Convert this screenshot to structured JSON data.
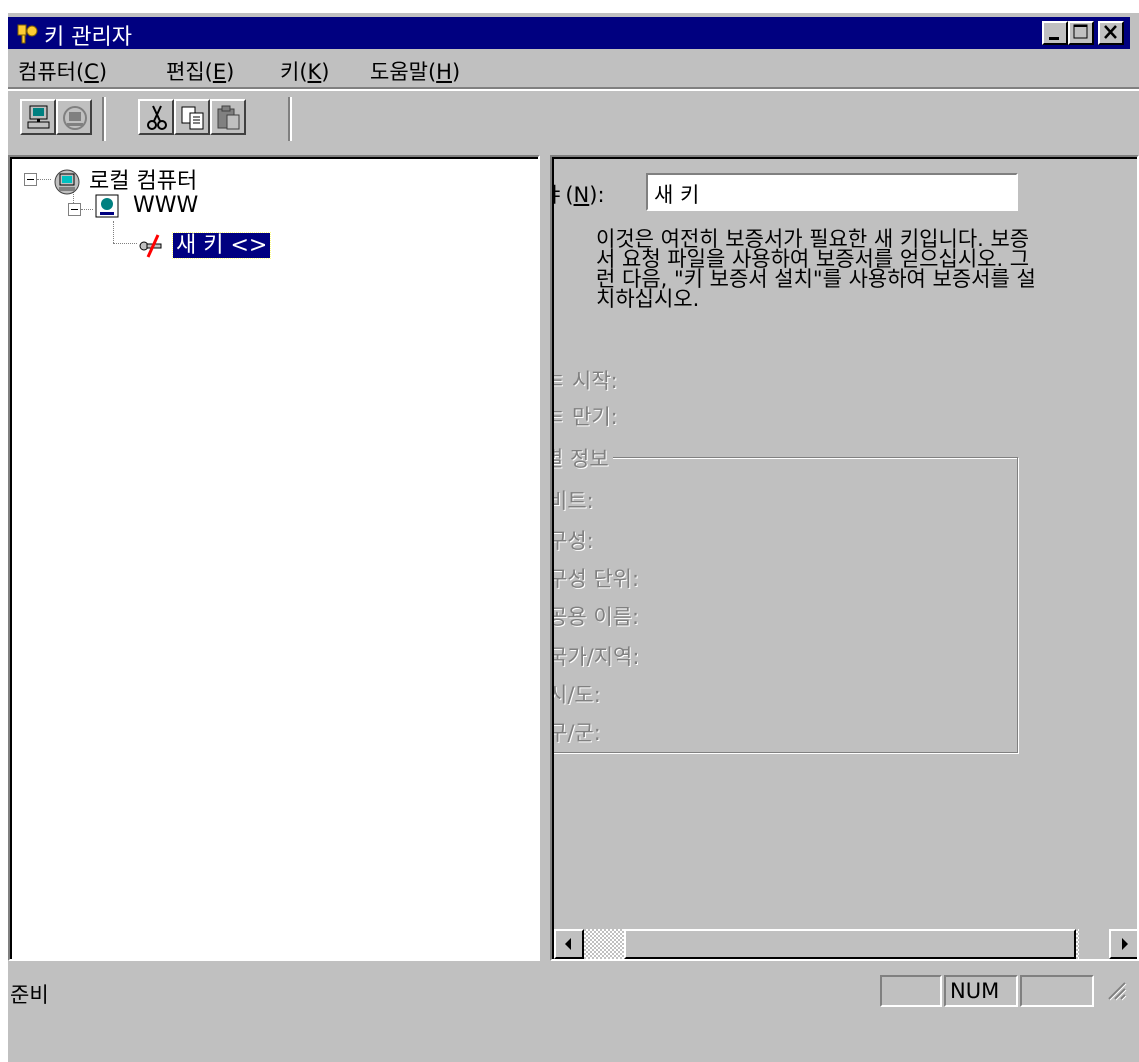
{
  "window": {
    "title": "키 관리자",
    "icon": "key-manager-icon"
  },
  "menu": [
    {
      "label": "컴퓨터(",
      "key": "C",
      "end": ")"
    },
    {
      "label": "편집(",
      "key": "E",
      "end": ")"
    },
    {
      "label": "키(",
      "key": "K",
      "end": ")"
    },
    {
      "label": "도움말(",
      "key": "H",
      "end": ")"
    }
  ],
  "toolbar": {
    "buttons": [
      "connect-computer-icon",
      "disconnect-computer-icon",
      "cut-icon",
      "copy-icon",
      "paste-icon"
    ]
  },
  "tree": {
    "root": "로컬 컴퓨터",
    "server": "WWW",
    "key": "새 키 <>"
  },
  "details": {
    "name_label_frag": "(",
    "name_label_key": "N",
    "name_label_end": "):",
    "name_value": "새 키",
    "desc_label": ":",
    "desc_text": "이것은 여전히 보증서가 필요한 새 키입니다. 보증서 요청 파일을 사용하여 보증서를 얻으십시오. 그런 다음, \"키 보증서 설치\"를 사용하여 보증서를 설치하십시오.",
    "start_label": "시작:",
    "expire_label": "만기:",
    "group_label": "정보",
    "fields": [
      "비트:",
      "구성:",
      "구성 단위:",
      "공용 이름:",
      "국가/지역:",
      "시/도:",
      "구/군:"
    ]
  },
  "status": {
    "text": "준비",
    "num": "NUM"
  }
}
